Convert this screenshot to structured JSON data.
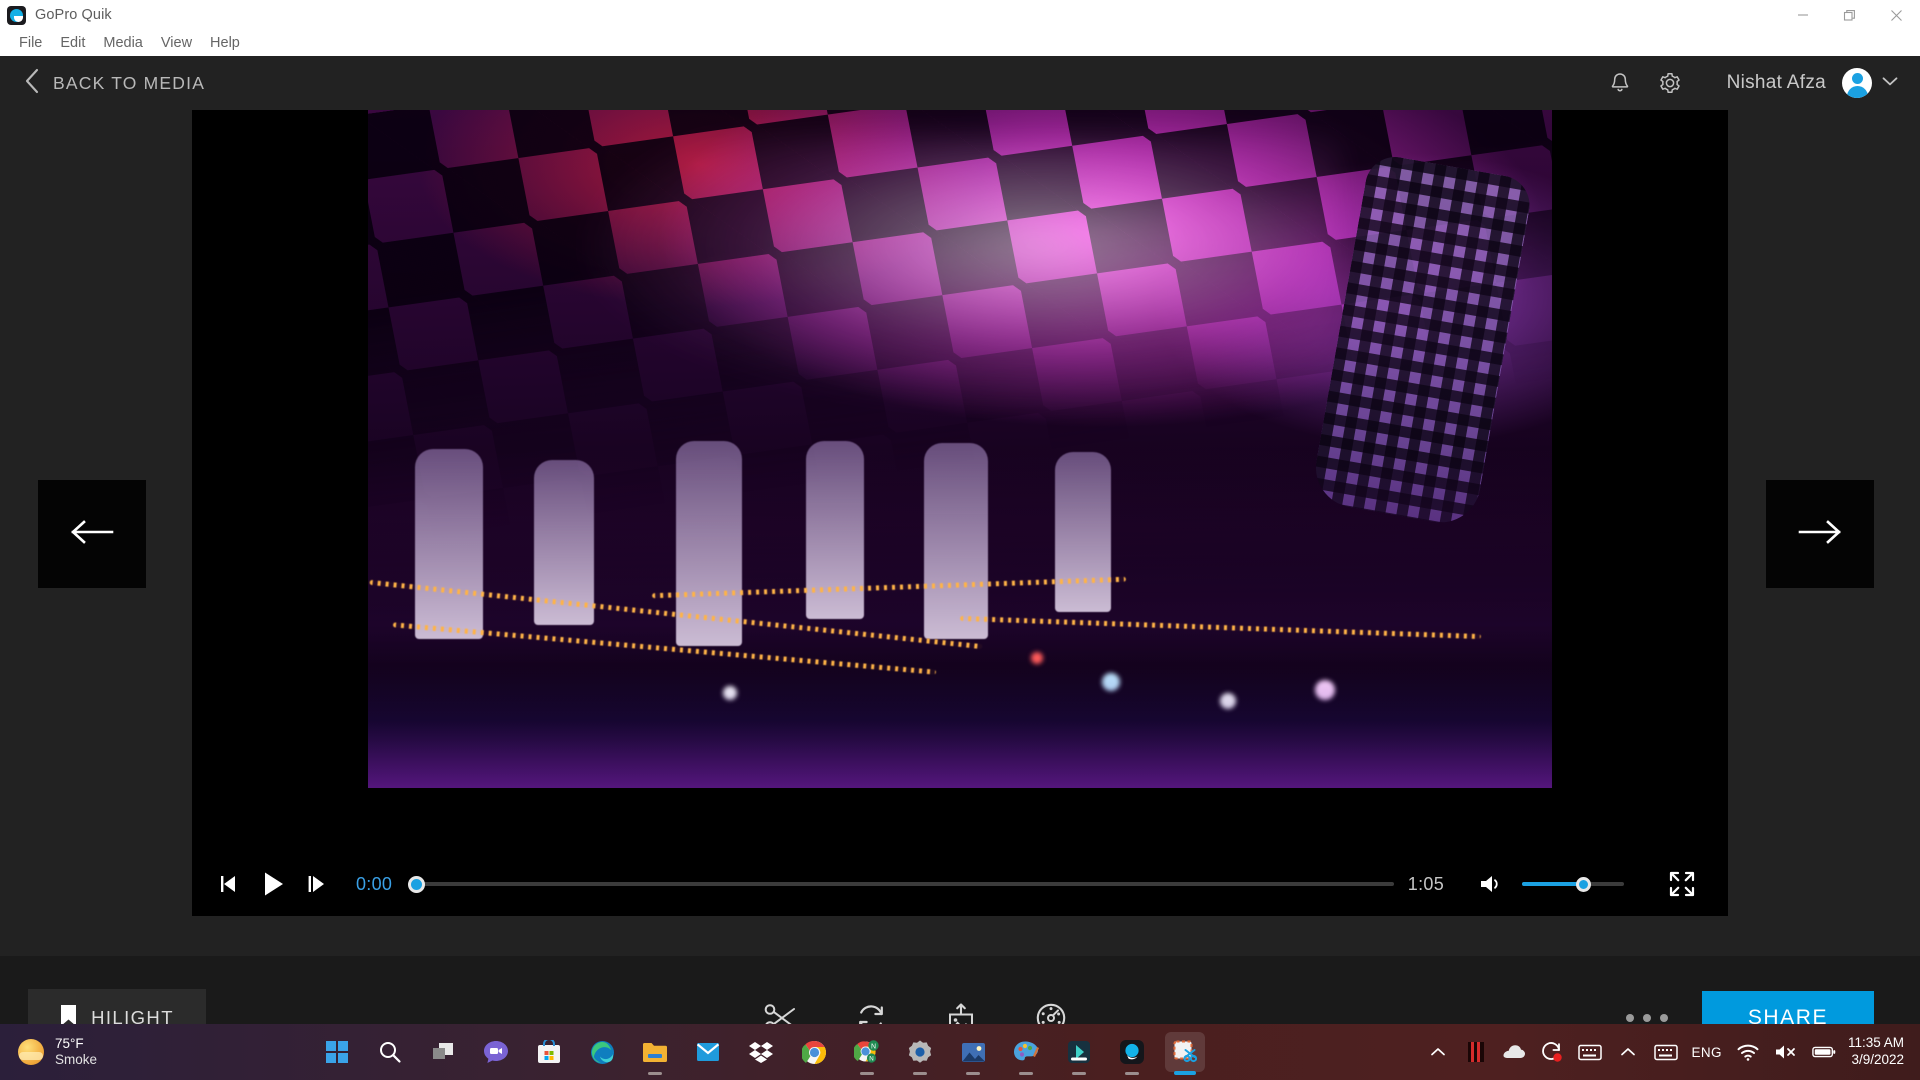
{
  "window": {
    "app_icon": "gopro-quik-icon",
    "title": "GoPro Quik",
    "minimize_label": "Minimize",
    "restore_label": "Restore",
    "close_label": "Close"
  },
  "menubar": {
    "items": [
      {
        "label": "File"
      },
      {
        "label": "Edit"
      },
      {
        "label": "Media"
      },
      {
        "label": "View"
      },
      {
        "label": "Help"
      }
    ]
  },
  "header": {
    "back_label": "BACK TO MEDIA",
    "back_icon": "chevron-left-icon",
    "notifications_icon": "bell-icon",
    "settings_icon": "gear-icon",
    "user_name": "Nishat Afza",
    "avatar_icon": "user-avatar",
    "caret_icon": "chevron-down-icon"
  },
  "navigation": {
    "prev_icon": "arrow-left-icon",
    "next_icon": "arrow-right-icon"
  },
  "player": {
    "prev_frame_icon": "step-backward-icon",
    "play_icon": "play-icon",
    "next_frame_icon": "step-forward-icon",
    "current_time": "0:00",
    "duration": "1:05",
    "progress_percent": 0,
    "volume_icon": "volume-on-icon",
    "volume_percent": 60,
    "fullscreen_icon": "fullscreen-icon",
    "accent_color": "#1ba1e2"
  },
  "toolbar": {
    "hilight_label": "HILIGHT",
    "hilight_icon": "bookmark-icon",
    "tools": [
      {
        "name": "trim-tool",
        "icon": "scissors-icon"
      },
      {
        "name": "rotate-tool",
        "icon": "rotate-icon"
      },
      {
        "name": "export-frame-tool",
        "icon": "image-upload-icon"
      },
      {
        "name": "speed-tool",
        "icon": "speed-dial-icon"
      }
    ],
    "more_label": "More options",
    "share_label": "SHARE",
    "share_color": "#009ade"
  },
  "taskbar": {
    "weather": {
      "icon": "sun-haze-icon",
      "temperature": "75°F",
      "condition": "Smoke"
    },
    "apps": [
      {
        "name": "start-button",
        "icon": "windows-logo-icon",
        "running": false
      },
      {
        "name": "search-button",
        "icon": "search-icon",
        "running": false
      },
      {
        "name": "task-view-button",
        "icon": "task-view-icon",
        "running": false
      },
      {
        "name": "chat-button",
        "icon": "chat-icon",
        "running": false
      },
      {
        "name": "microsoft-store",
        "icon": "store-icon",
        "running": false
      },
      {
        "name": "microsoft-edge",
        "icon": "edge-icon",
        "running": false
      },
      {
        "name": "file-explorer",
        "icon": "folder-icon",
        "running": true
      },
      {
        "name": "mail-app",
        "icon": "mail-icon",
        "running": false
      },
      {
        "name": "dropbox",
        "icon": "dropbox-icon",
        "running": false
      },
      {
        "name": "google-chrome",
        "icon": "chrome-icon",
        "running": false
      },
      {
        "name": "chrome-apps",
        "icon": "chrome-notes-icon",
        "running": true
      },
      {
        "name": "settings-app",
        "icon": "settings-gear-icon",
        "running": true
      },
      {
        "name": "photos-app",
        "icon": "photos-icon",
        "running": true
      },
      {
        "name": "paint-app",
        "icon": "paint-palette-icon",
        "running": true
      },
      {
        "name": "media-editor-app",
        "icon": "media-editor-icon",
        "running": true
      },
      {
        "name": "gopro-quik-app",
        "icon": "gopro-quik-icon",
        "running": true
      },
      {
        "name": "snipping-tool",
        "icon": "snipping-tool-icon",
        "running": true
      }
    ],
    "tray": {
      "overflow_icon": "chevron-up-icon",
      "items": [
        {
          "name": "tray-app-icon",
          "icon": "app-stripe-icon"
        },
        {
          "name": "onedrive-icon",
          "icon": "cloud-icon"
        },
        {
          "name": "screen-recorder-icon",
          "icon": "record-icon"
        },
        {
          "name": "touch-keyboard-icon",
          "icon": "keyboard-icon"
        }
      ],
      "second_overflow_icon": "chevron-up-icon",
      "keyboard_icon": "keyboard-icon",
      "language": "ENG",
      "network_icon": "wifi-icon",
      "volume_icon": "volume-muted-icon",
      "battery_icon": "battery-icon"
    },
    "clock": {
      "time": "11:35 AM",
      "date": "3/9/2022"
    }
  }
}
